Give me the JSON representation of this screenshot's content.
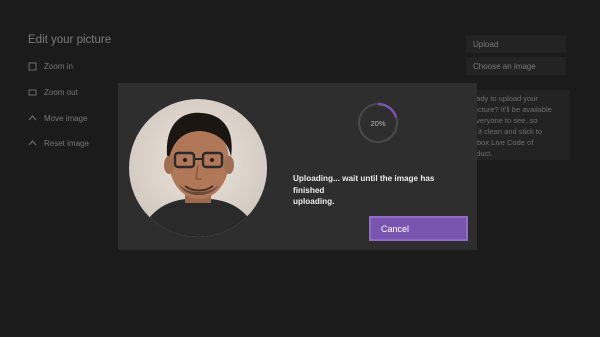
{
  "page": {
    "title": "Edit your picture"
  },
  "sidebar": {
    "items": [
      {
        "label": "Zoom in",
        "icon": "zoom-in-icon"
      },
      {
        "label": "Zoom out",
        "icon": "zoom-out-icon"
      },
      {
        "label": "Move image",
        "icon": "move-icon"
      },
      {
        "label": "Reset image",
        "icon": "reset-icon"
      }
    ]
  },
  "right_panel": {
    "upload_label": "Upload",
    "choose_label": "Choose an image",
    "info_lines": [
      "eady to upload your",
      "picture? It'll be available",
      "everyone to see, so",
      "p it clean and stick to",
      "Xbox Live Code of",
      "nduct."
    ]
  },
  "modal": {
    "progress_percent": 20,
    "progress_label": "20%",
    "status_line1": "Uploading... wait until the image has finished",
    "status_line2": "uploading.",
    "cancel_label": "Cancel",
    "accent_color": "#7a55b0"
  }
}
